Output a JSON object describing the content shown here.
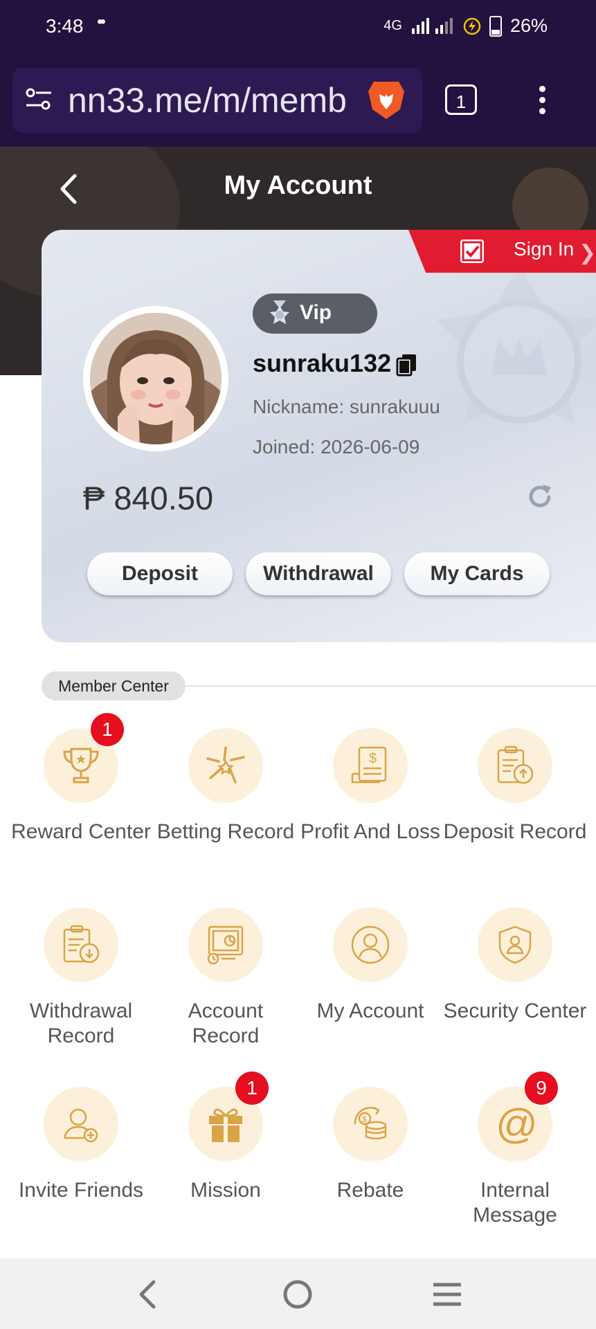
{
  "status_bar": {
    "time": "3:48",
    "signal_left": "••",
    "network": "4G",
    "battery": "26%"
  },
  "browser": {
    "url": "nn33.me/m/memb",
    "tab_count": "1"
  },
  "header": {
    "title": "My Account"
  },
  "profile": {
    "sign_in": "Sign In",
    "vip_label": "Vip",
    "username": "sunraku132",
    "nickname": "Nickname: sunrakuuu",
    "joined": "Joined:  2026-06-09",
    "balance": "₱ 840.50"
  },
  "actions": {
    "deposit": "Deposit",
    "withdrawal": "Withdrawal",
    "my_cards": "My Cards"
  },
  "member_center": {
    "title": "Member Center",
    "items": [
      {
        "label": "Reward Center",
        "icon": "trophy-icon",
        "badge": "1"
      },
      {
        "label": "Betting Record",
        "icon": "sparkle-icon",
        "badge": ""
      },
      {
        "label": "Profit And Loss",
        "icon": "bill-icon",
        "badge": ""
      },
      {
        "label": "Deposit Record",
        "icon": "clipboard-upload-icon",
        "badge": ""
      },
      {
        "label": "Withdrawal Record",
        "icon": "clipboard-download-icon",
        "badge": ""
      },
      {
        "label": "Account Record",
        "icon": "chart-icon",
        "badge": ""
      },
      {
        "label": "My Account",
        "icon": "user-icon",
        "badge": ""
      },
      {
        "label": "Security Center",
        "icon": "shield-icon",
        "badge": ""
      },
      {
        "label": "Invite Friends",
        "icon": "add-user-icon",
        "badge": ""
      },
      {
        "label": "Mission",
        "icon": "gift-icon",
        "badge": "1"
      },
      {
        "label": "Rebate",
        "icon": "coins-icon",
        "badge": ""
      },
      {
        "label": "Internal Message",
        "icon": "at-icon",
        "badge": "9"
      }
    ]
  },
  "colors": {
    "accent": "#e21c30",
    "icon_gold": "#d9a347",
    "icon_bg": "#fdf0da",
    "badge": "#e60f1f"
  }
}
